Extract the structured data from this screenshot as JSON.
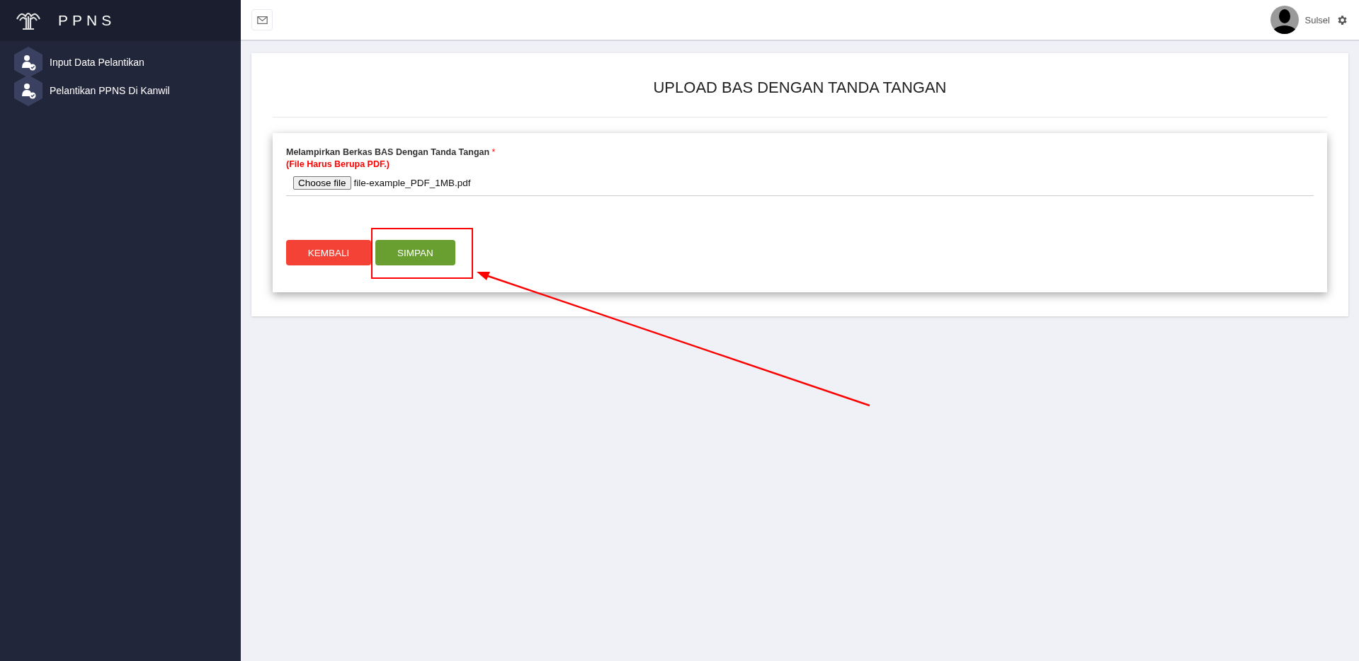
{
  "brand": {
    "name": "PPNS"
  },
  "sidebar": {
    "items": [
      {
        "label": "Input Data Pelantikan"
      },
      {
        "label": "Pelantikan PPNS Di Kanwil"
      }
    ]
  },
  "header": {
    "user": "Sulsel"
  },
  "page": {
    "title": "UPLOAD BAS DENGAN TANDA TANGAN"
  },
  "form": {
    "label": "Melampirkan Berkas BAS Dengan Tanda Tangan",
    "required_mark": "*",
    "hint": "(File Harus Berupa PDF.)",
    "file_button": "Choose file",
    "file_name": "file-example_PDF_1MB.pdf"
  },
  "buttons": [
    {
      "label": "KEMBALI",
      "kind": "danger"
    },
    {
      "label": "SIMPAN",
      "kind": "success",
      "highlighted": true
    }
  ]
}
